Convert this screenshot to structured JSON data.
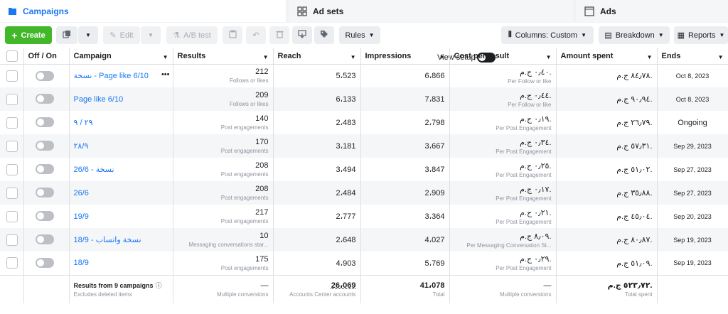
{
  "tabs": [
    {
      "label": "Campaigns"
    },
    {
      "label": "Ad sets"
    },
    {
      "label": "Ads"
    }
  ],
  "toolbar": {
    "create": "Create",
    "edit": "Edit",
    "ab_test": "A/B test",
    "rules": "Rules",
    "view_setup": "View setup",
    "columns": "Columns: Custom",
    "breakdown": "Breakdown",
    "reports": "Reports"
  },
  "columns": [
    "Off / On",
    "Campaign",
    "Results",
    "Reach",
    "Impressions",
    "Cost per result",
    "Amount spent",
    "Ends"
  ],
  "rows": [
    {
      "campaign": "نسخة - Page like 6/10",
      "results": "212",
      "results_type": "Follows or likes",
      "reach": "5،523",
      "impressions": "6،866",
      "cost": "٠٫٤٠ ج.م.",
      "cost_type": "Per Follow or like",
      "spent": "٨٤٫٧٨ ج.م.",
      "ends": "Oct 8, 2023"
    },
    {
      "campaign": "Page like 6/10",
      "results": "209",
      "results_type": "Follows or likes",
      "reach": "6،133",
      "impressions": "7،831",
      "cost": "٠٫٤٤ ج.م.",
      "cost_type": "Per Follow or like",
      "spent": "٩٠٫٩٤ ج.م.",
      "ends": "Oct 8, 2023"
    },
    {
      "campaign": "٢٩ / ٩",
      "results": "140",
      "results_type": "Post engagements",
      "reach": "2،483",
      "impressions": "2،798",
      "cost": "٠٫١٩ ج.م.",
      "cost_type": "Per Post Engagement",
      "spent": "٢٦٫٧٩ ج.م.",
      "ends": "Ongoing"
    },
    {
      "campaign": "٢٨/٩",
      "results": "170",
      "results_type": "Post engagements",
      "reach": "3،181",
      "impressions": "3،667",
      "cost": "٠٫٣٤ ج.م.",
      "cost_type": "Per Post Engagement",
      "spent": "٥٧٫٣١ ج.م.",
      "ends": "Sep 29, 2023"
    },
    {
      "campaign": "نسخة - 26/6",
      "results": "208",
      "results_type": "Post engagements",
      "reach": "3،494",
      "impressions": "3،847",
      "cost": "٠٫٢٥ ج.م.",
      "cost_type": "Per Post Engagement",
      "spent": "٥١٫٠٢ ج.م.",
      "ends": "Sep 27, 2023"
    },
    {
      "campaign": "26/6",
      "results": "208",
      "results_type": "Post engagements",
      "reach": "2،484",
      "impressions": "2،909",
      "cost": "٠٫١٧ ج.م.",
      "cost_type": "Per Post Engagement",
      "spent": "٣٥٫٨٨ ج.م.",
      "ends": "Sep 27, 2023"
    },
    {
      "campaign": "19/9",
      "results": "217",
      "results_type": "Post engagements",
      "reach": "2،777",
      "impressions": "3،364",
      "cost": "٠٫٢١ ج.م.",
      "cost_type": "Per Post Engagement",
      "spent": "٤٥٫٠٤ ج.م.",
      "ends": "Sep 20, 2023"
    },
    {
      "campaign": "18/9 - نسخة واتساب",
      "results": "10",
      "results_type": "Messaging conversations star...",
      "reach": "2،648",
      "impressions": "4،027",
      "cost": "٨٫٠٩ ج.م.",
      "cost_type": "Per Messaging Conversation St...",
      "spent": "٨٠٫٨٧ ج.م.",
      "ends": "Sep 19, 2023"
    },
    {
      "campaign": "18/9",
      "results": "175",
      "results_type": "Post engagements",
      "reach": "4،903",
      "impressions": "5،769",
      "cost": "٠٫٢٩ ج.م.",
      "cost_type": "Per Post Engagement",
      "spent": "٥١٫٠٩ ج.م.",
      "ends": "Sep 19, 2023"
    }
  ],
  "total": {
    "label": "Results from 9 campaigns",
    "sub": "Excludes deleted items",
    "results": "—",
    "results_sub": "Multiple conversions",
    "reach": "26،069",
    "reach_sub": "Accounts Center accounts",
    "impressions": "41،078",
    "impressions_sub": "Total",
    "cost": "—",
    "cost_sub": "Multiple conversions",
    "spent": "٥٢٣٫٧٢ ج.م.",
    "spent_sub": "Total spent"
  }
}
